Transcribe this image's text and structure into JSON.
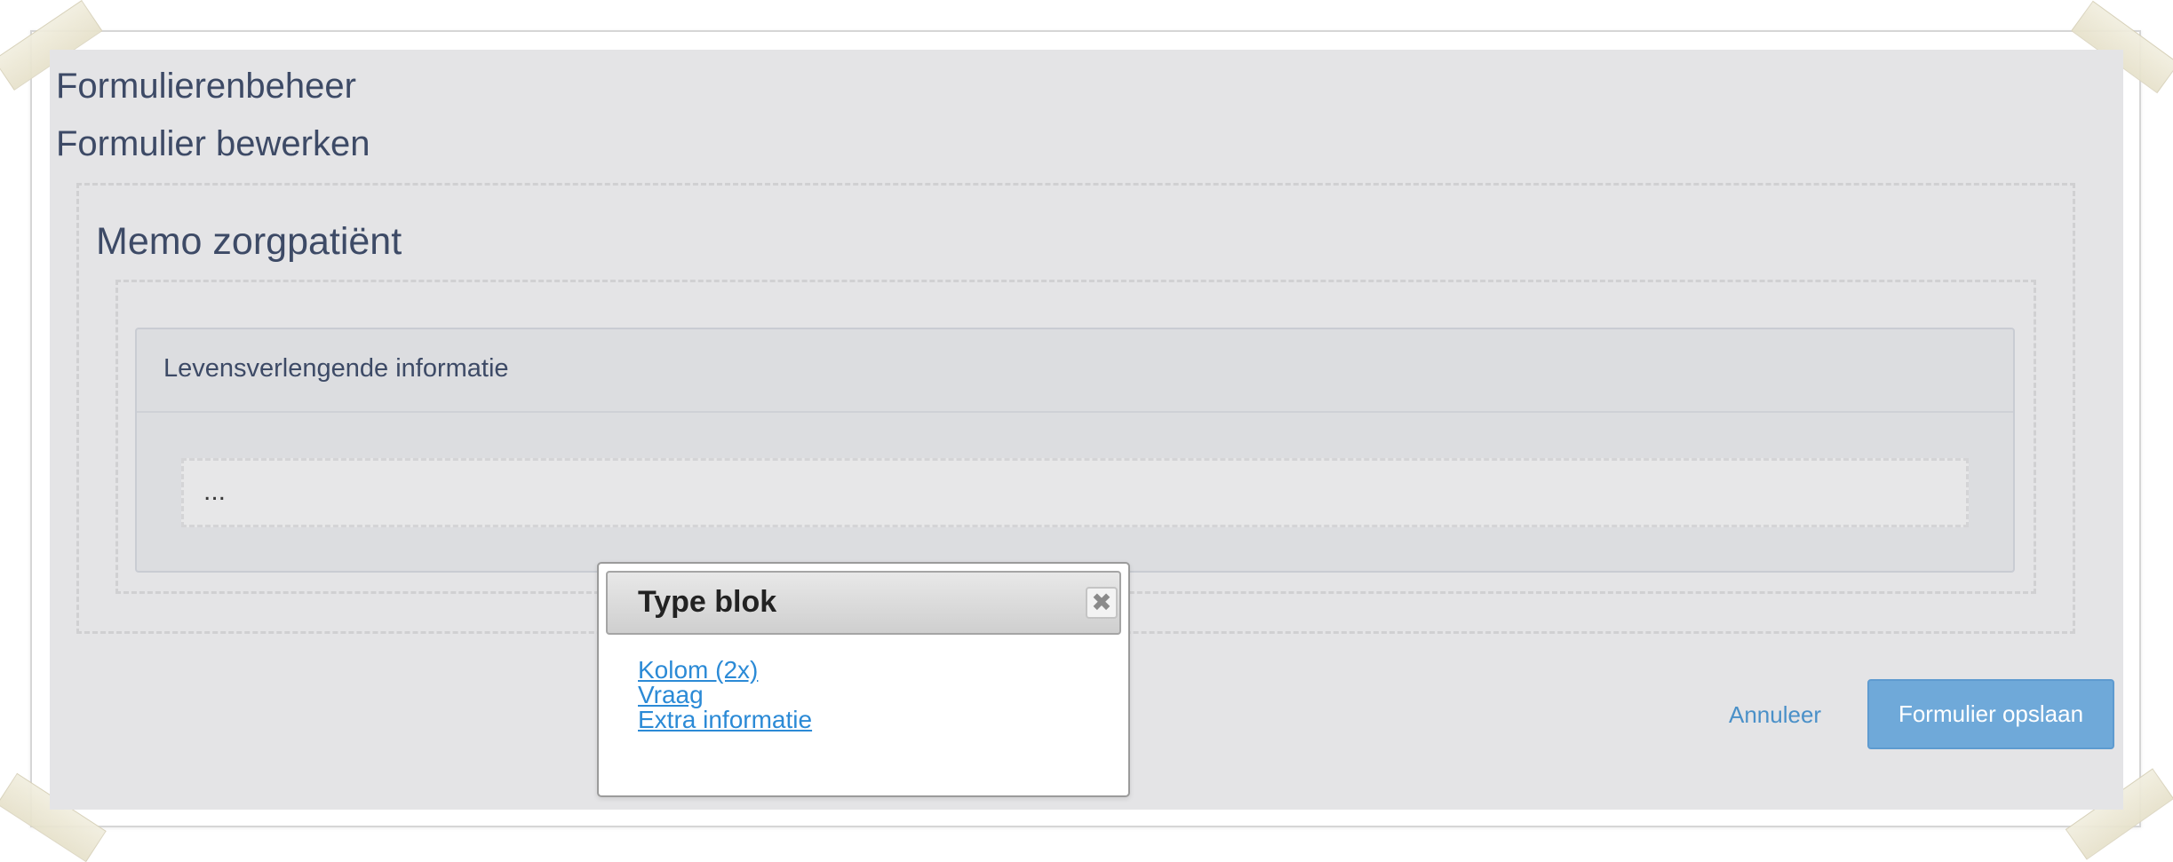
{
  "page": {
    "section_title": "Formulierenbeheer",
    "subtitle": "Formulier bewerken"
  },
  "form": {
    "title": "Memo zorgpatiënt",
    "panel_title": "Levensverlengende informatie",
    "placeholder_text": "..."
  },
  "actions": {
    "cancel_label": "Annuleer",
    "save_label": "Formulier opslaan"
  },
  "dialog": {
    "title": "Type blok",
    "close_icon": "close-icon",
    "options": [
      "Kolom (2x)",
      "Vraag",
      "Extra informatie"
    ]
  },
  "colors": {
    "heading": "#3d4a66",
    "link": "#2b8ad6",
    "save_button": "#6fa9d9",
    "cancel_link": "#4a90c8"
  }
}
